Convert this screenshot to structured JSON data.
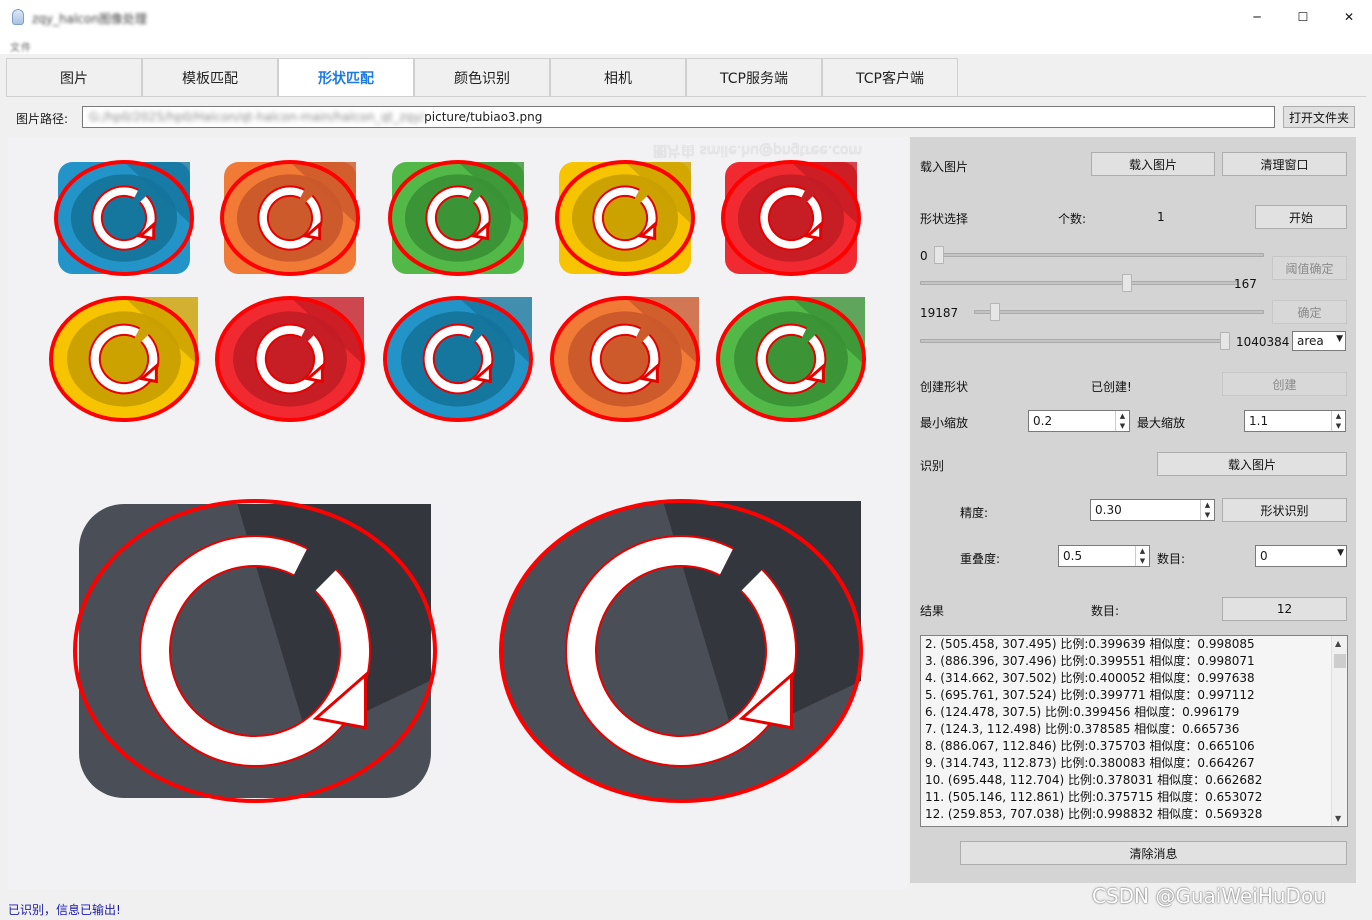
{
  "window": {
    "title": "zqy_halcon图像处理",
    "minimize": "─",
    "maximize": "☐",
    "close": "✕"
  },
  "menu": {
    "item": "文件"
  },
  "tabs": [
    {
      "label": "图片",
      "active": false
    },
    {
      "label": "模板匹配",
      "active": false
    },
    {
      "label": "形状匹配",
      "active": true
    },
    {
      "label": "颜色识别",
      "active": false
    },
    {
      "label": "相机",
      "active": false
    },
    {
      "label": "TCP服务端",
      "active": false
    },
    {
      "label": "TCP客户端",
      "active": false
    }
  ],
  "path": {
    "label": "图片路径:",
    "blurred_prefix": "G:/hp0/2025/hp0/Halcon/qt-halcon-main/halcon_qt_zqy/",
    "value": "picture/tubiao3.png",
    "open_button": "打开文件夹"
  },
  "canvas": {
    "watermark": "图片由 smile.hu@pngtree.com"
  },
  "panel": {
    "load_label": "载入图片",
    "load_button": "载入图片",
    "clear_window_button": "清理窗口",
    "shape_select_label": "形状选择",
    "count_label": "个数:",
    "count_value": "1",
    "start_button": "开始",
    "slider1_min": "0",
    "slider1_val": "167",
    "threshold_button": "阈值确定",
    "slider2_min": "19187",
    "slider2_val": "1040384",
    "confirm_button": "确定",
    "feature_combo": "area",
    "create_shape_label": "创建形状",
    "created_status": "已创建!",
    "create_button": "创建",
    "min_scale_label": "最小缩放",
    "min_scale_value": "0.2",
    "max_scale_label": "最大缩放",
    "max_scale_value": "1.1",
    "recognize_label": "识别",
    "recognize_load_button": "载入图片",
    "precision_label": "精度:",
    "precision_value": "0.30",
    "shape_recognize_button": "形状识别",
    "overlap_label": "重叠度:",
    "overlap_value": "0.5",
    "number_label": "数目:",
    "number_combo": "0",
    "result_label": "结果",
    "result_count_label": "数目:",
    "result_count_button": "12",
    "clear_messages_button": "清除消息"
  },
  "results": [
    "2. (505.458, 307.495) 比例:0.399639 相似度：0.998085",
    "3. (886.396, 307.496) 比例:0.399551 相似度：0.998071",
    "4. (314.662, 307.502) 比例:0.400052 相似度：0.997638",
    "5. (695.761, 307.524) 比例:0.399771 相似度：0.997112",
    "6. (124.478, 307.5) 比例:0.399456 相似度：0.996179",
    "7. (124.3, 112.498) 比例:0.378585 相似度：0.665736",
    "8. (886.067, 112.846) 比例:0.375703 相似度：0.665106",
    "9. (314.743, 112.873) 比例:0.380083 相似度：0.664267",
    "10. (695.448, 112.704) 比例:0.378031 相似度：0.662682",
    "11. (505.146, 112.861) 比例:0.375715 相似度：0.653072",
    "12. (259.853, 707.038) 比例:0.998832 相似度：0.569328"
  ],
  "status": {
    "text": "已识别，信息已输出!"
  },
  "watermark_corner": "CSDN @GuaiWeiHuDou",
  "colors": {
    "accent_tab": "#1e7be3",
    "match_red": "#ff0000",
    "icon_blue": [
      "#2394c8",
      "#15749c"
    ],
    "icon_orange": [
      "#f07a36",
      "#c9582a"
    ],
    "icon_green": [
      "#52b848",
      "#3a9236"
    ],
    "icon_yellow": [
      "#f6c400",
      "#c9a000"
    ],
    "icon_red": [
      "#f02a30",
      "#c41c24"
    ],
    "icon_dark": [
      "#4a4e56",
      "#33363d"
    ]
  },
  "icons": {
    "row1": [
      "blue",
      "orange",
      "green",
      "yellow",
      "red"
    ],
    "row2": [
      "yellow",
      "red",
      "blue",
      "orange",
      "green"
    ]
  }
}
